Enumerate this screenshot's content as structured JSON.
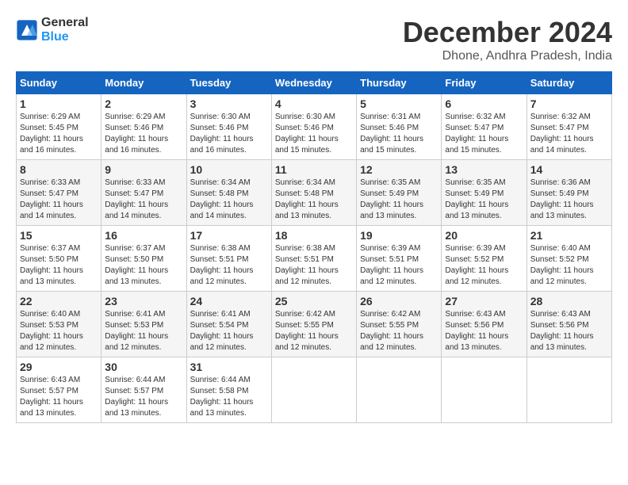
{
  "header": {
    "logo_text_general": "General",
    "logo_text_blue": "Blue",
    "month_title": "December 2024",
    "location": "Dhone, Andhra Pradesh, India"
  },
  "calendar": {
    "days_of_week": [
      "Sunday",
      "Monday",
      "Tuesday",
      "Wednesday",
      "Thursday",
      "Friday",
      "Saturday"
    ],
    "weeks": [
      [
        {
          "day": "1",
          "sunrise": "6:29 AM",
          "sunset": "5:45 PM",
          "daylight": "11 hours and 16 minutes."
        },
        {
          "day": "2",
          "sunrise": "6:29 AM",
          "sunset": "5:46 PM",
          "daylight": "11 hours and 16 minutes."
        },
        {
          "day": "3",
          "sunrise": "6:30 AM",
          "sunset": "5:46 PM",
          "daylight": "11 hours and 16 minutes."
        },
        {
          "day": "4",
          "sunrise": "6:30 AM",
          "sunset": "5:46 PM",
          "daylight": "11 hours and 15 minutes."
        },
        {
          "day": "5",
          "sunrise": "6:31 AM",
          "sunset": "5:46 PM",
          "daylight": "11 hours and 15 minutes."
        },
        {
          "day": "6",
          "sunrise": "6:32 AM",
          "sunset": "5:47 PM",
          "daylight": "11 hours and 15 minutes."
        },
        {
          "day": "7",
          "sunrise": "6:32 AM",
          "sunset": "5:47 PM",
          "daylight": "11 hours and 14 minutes."
        }
      ],
      [
        {
          "day": "8",
          "sunrise": "6:33 AM",
          "sunset": "5:47 PM",
          "daylight": "11 hours and 14 minutes."
        },
        {
          "day": "9",
          "sunrise": "6:33 AM",
          "sunset": "5:47 PM",
          "daylight": "11 hours and 14 minutes."
        },
        {
          "day": "10",
          "sunrise": "6:34 AM",
          "sunset": "5:48 PM",
          "daylight": "11 hours and 14 minutes."
        },
        {
          "day": "11",
          "sunrise": "6:34 AM",
          "sunset": "5:48 PM",
          "daylight": "11 hours and 13 minutes."
        },
        {
          "day": "12",
          "sunrise": "6:35 AM",
          "sunset": "5:49 PM",
          "daylight": "11 hours and 13 minutes."
        },
        {
          "day": "13",
          "sunrise": "6:35 AM",
          "sunset": "5:49 PM",
          "daylight": "11 hours and 13 minutes."
        },
        {
          "day": "14",
          "sunrise": "6:36 AM",
          "sunset": "5:49 PM",
          "daylight": "11 hours and 13 minutes."
        }
      ],
      [
        {
          "day": "15",
          "sunrise": "6:37 AM",
          "sunset": "5:50 PM",
          "daylight": "11 hours and 13 minutes."
        },
        {
          "day": "16",
          "sunrise": "6:37 AM",
          "sunset": "5:50 PM",
          "daylight": "11 hours and 13 minutes."
        },
        {
          "day": "17",
          "sunrise": "6:38 AM",
          "sunset": "5:51 PM",
          "daylight": "11 hours and 12 minutes."
        },
        {
          "day": "18",
          "sunrise": "6:38 AM",
          "sunset": "5:51 PM",
          "daylight": "11 hours and 12 minutes."
        },
        {
          "day": "19",
          "sunrise": "6:39 AM",
          "sunset": "5:51 PM",
          "daylight": "11 hours and 12 minutes."
        },
        {
          "day": "20",
          "sunrise": "6:39 AM",
          "sunset": "5:52 PM",
          "daylight": "11 hours and 12 minutes."
        },
        {
          "day": "21",
          "sunrise": "6:40 AM",
          "sunset": "5:52 PM",
          "daylight": "11 hours and 12 minutes."
        }
      ],
      [
        {
          "day": "22",
          "sunrise": "6:40 AM",
          "sunset": "5:53 PM",
          "daylight": "11 hours and 12 minutes."
        },
        {
          "day": "23",
          "sunrise": "6:41 AM",
          "sunset": "5:53 PM",
          "daylight": "11 hours and 12 minutes."
        },
        {
          "day": "24",
          "sunrise": "6:41 AM",
          "sunset": "5:54 PM",
          "daylight": "11 hours and 12 minutes."
        },
        {
          "day": "25",
          "sunrise": "6:42 AM",
          "sunset": "5:55 PM",
          "daylight": "11 hours and 12 minutes."
        },
        {
          "day": "26",
          "sunrise": "6:42 AM",
          "sunset": "5:55 PM",
          "daylight": "11 hours and 12 minutes."
        },
        {
          "day": "27",
          "sunrise": "6:43 AM",
          "sunset": "5:56 PM",
          "daylight": "11 hours and 13 minutes."
        },
        {
          "day": "28",
          "sunrise": "6:43 AM",
          "sunset": "5:56 PM",
          "daylight": "11 hours and 13 minutes."
        }
      ],
      [
        {
          "day": "29",
          "sunrise": "6:43 AM",
          "sunset": "5:57 PM",
          "daylight": "11 hours and 13 minutes."
        },
        {
          "day": "30",
          "sunrise": "6:44 AM",
          "sunset": "5:57 PM",
          "daylight": "11 hours and 13 minutes."
        },
        {
          "day": "31",
          "sunrise": "6:44 AM",
          "sunset": "5:58 PM",
          "daylight": "11 hours and 13 minutes."
        },
        null,
        null,
        null,
        null
      ]
    ]
  }
}
